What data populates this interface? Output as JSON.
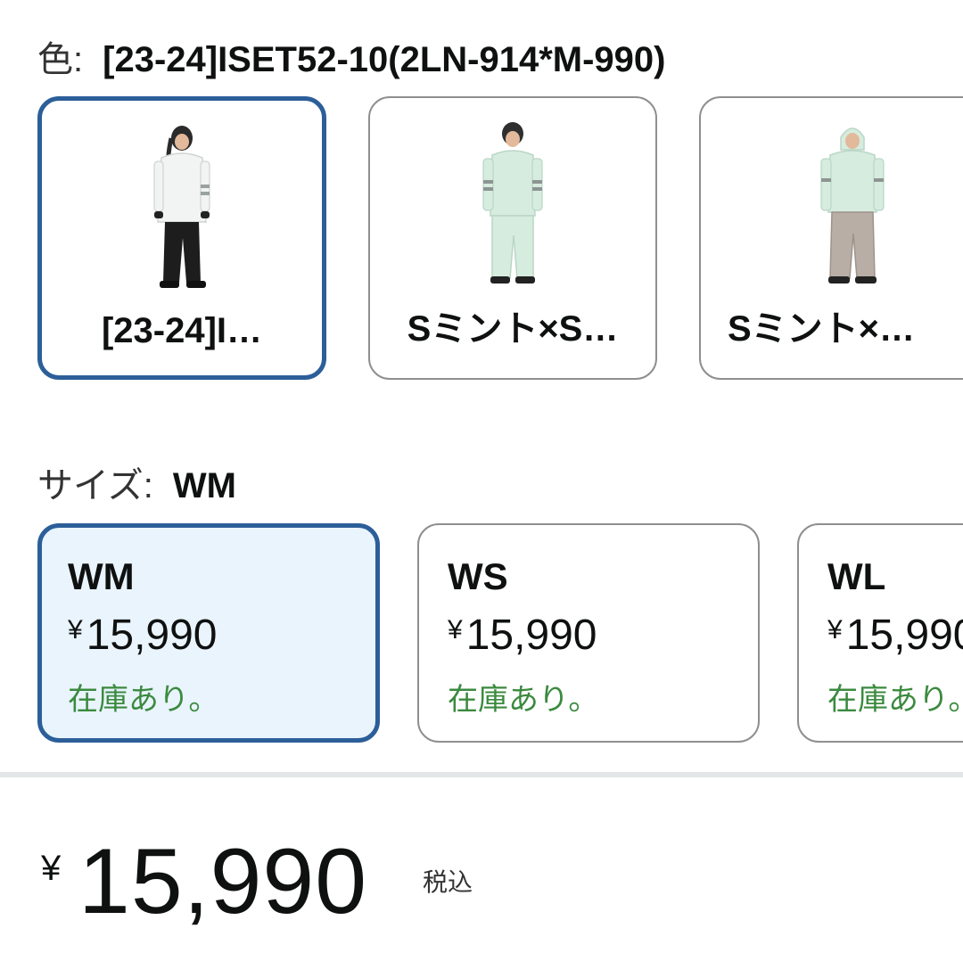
{
  "color": {
    "label": "色:",
    "selected": "[23-24]ISET52-10(2LN-914*M-990)",
    "options": [
      {
        "caption": "[23-24]I…",
        "selected": true,
        "jacket": "#f2f4f3",
        "pants": "#1d1d1d"
      },
      {
        "caption": "Sミント×S…",
        "selected": false,
        "jacket": "#d6ecdf",
        "pants": "#d6ecdf"
      },
      {
        "caption": "Sミント×…",
        "selected": false,
        "jacket": "#d6ecdf",
        "pants": "#b8aea6"
      }
    ]
  },
  "size": {
    "label": "サイズ:",
    "selected": "WM",
    "options": [
      {
        "name": "WM",
        "currency": "¥",
        "price": "15,990",
        "stock": "在庫あり。",
        "selected": true
      },
      {
        "name": "WS",
        "currency": "¥",
        "price": "15,990",
        "stock": "在庫あり。",
        "selected": false
      },
      {
        "name": "WL",
        "currency": "¥",
        "price": "15,990",
        "stock": "在庫あり。",
        "selected": false
      }
    ]
  },
  "price": {
    "currency": "¥",
    "amount": "15,990",
    "tax_note": "税込"
  },
  "colors": {
    "selected_border": "#2c5f99",
    "selected_bg": "#e9f4fd",
    "stock_green": "#3b8a3f"
  }
}
